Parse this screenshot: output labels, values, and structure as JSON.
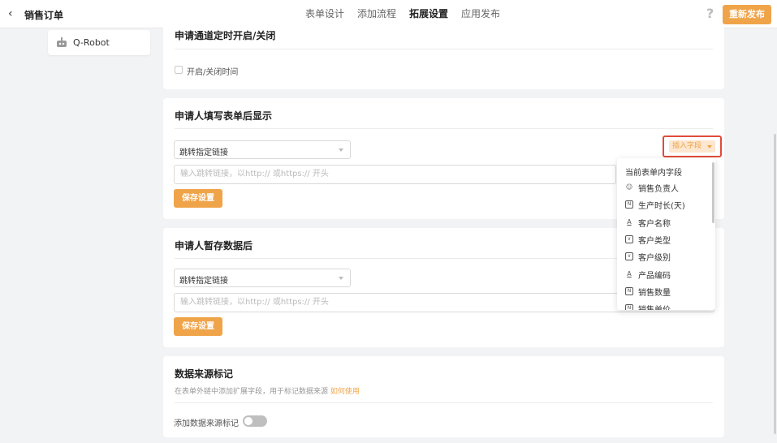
{
  "header": {
    "back_icon": "chevron-left-icon",
    "title": "销售订单",
    "tabs": [
      {
        "label": "表单设计",
        "active": false
      },
      {
        "label": "添加流程",
        "active": false
      },
      {
        "label": "拓展设置",
        "active": true
      },
      {
        "label": "应用发布",
        "active": false
      }
    ],
    "help_icon": "question-icon",
    "publish_label": "重新发布"
  },
  "sidebar": {
    "items": [
      {
        "label": "Q-Robot",
        "icon": "robot-icon"
      }
    ]
  },
  "section_timer": {
    "title": "申请通道定时开启/关闭",
    "checkbox_label": "开启/关闭时间",
    "checked": false
  },
  "section_after_submit": {
    "title": "申请人填写表单后显示",
    "select_value": "跳转指定链接",
    "input_placeholder": "输入跳转链接，以http:// 或https:// 开头",
    "save_label": "保存设置",
    "insert_field_label": "插入字段"
  },
  "insert_field_dropdown": {
    "header": "当前表单内字段",
    "items": [
      {
        "label": "销售负责人",
        "icon": "user-icon"
      },
      {
        "label": "生产时长(天)",
        "icon": "number-field-icon"
      },
      {
        "label": "客户名称",
        "icon": "text-field-icon"
      },
      {
        "label": "客户类型",
        "icon": "select-field-icon"
      },
      {
        "label": "客户级别",
        "icon": "select-field-icon"
      },
      {
        "label": "产品编码",
        "icon": "text-field-icon"
      },
      {
        "label": "销售数量",
        "icon": "number-field-icon"
      },
      {
        "label": "销售单价",
        "icon": "number-field-icon"
      }
    ]
  },
  "section_after_save": {
    "title": "申请人暂存数据后",
    "select_value": "跳转指定链接",
    "input_placeholder": "输入跳转链接，以http:// 或https:// 开头",
    "save_label": "保存设置"
  },
  "section_source": {
    "title": "数据来源标记",
    "hint": "在表单外链中添加扩展字段，用于标记数据来源",
    "hint_link": "如何使用",
    "toggle_label": "添加数据来源标记",
    "toggle_on": false
  },
  "colors": {
    "accent": "#f0a44a",
    "highlight_border": "#e04b3a"
  }
}
